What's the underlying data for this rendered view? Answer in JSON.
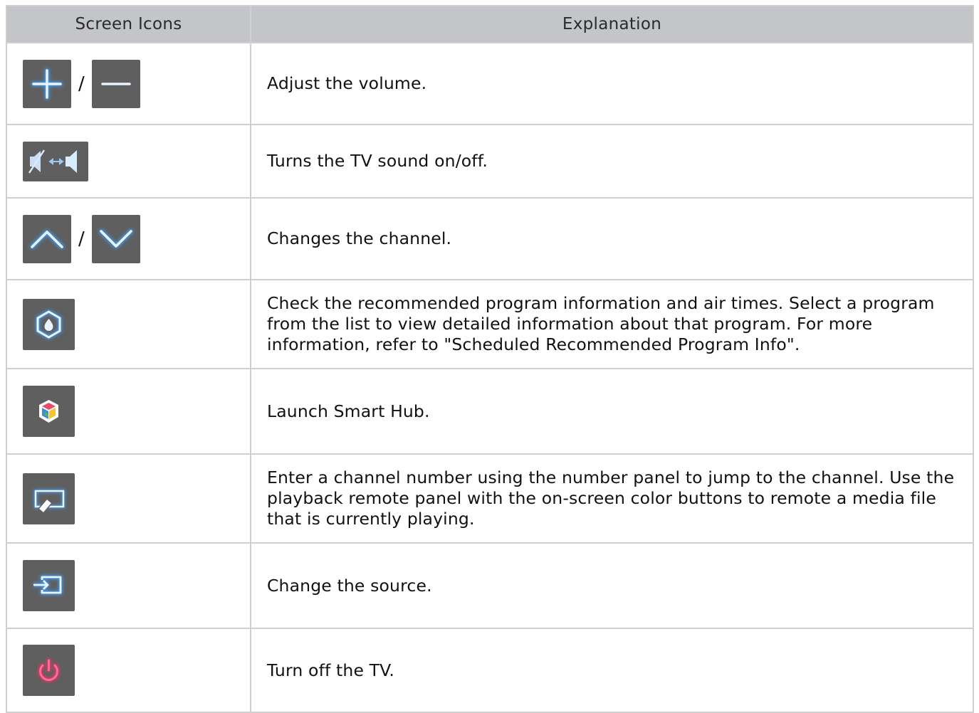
{
  "header": {
    "col_icons": "Screen Icons",
    "col_explanation": "Explanation"
  },
  "separator": "/",
  "rows": [
    {
      "icons": [
        "plus-icon",
        "minus-icon"
      ],
      "text": "Adjust the volume."
    },
    {
      "icons": [
        "mute-toggle-icon"
      ],
      "text": "Turns the TV sound on/off."
    },
    {
      "icons": [
        "chevron-up-icon",
        "chevron-down-icon"
      ],
      "text": "Changes the channel."
    },
    {
      "icons": [
        "recommended-program-icon"
      ],
      "text": "Check the recommended program information and air times. Select a program from the list to view detailed information about that program. For more information, refer to \"Scheduled Recommended Program Info\"."
    },
    {
      "icons": [
        "smart-hub-icon"
      ],
      "text": "Launch Smart Hub."
    },
    {
      "icons": [
        "remote-panel-icon"
      ],
      "text": "Enter a channel number using the number panel to jump to the channel. Use the playback remote panel with the on-screen color buttons to remote a media file that is currently playing."
    },
    {
      "icons": [
        "source-icon"
      ],
      "text": "Change the source."
    },
    {
      "icons": [
        "power-icon"
      ],
      "text": "Turn off the TV."
    }
  ],
  "colors": {
    "header_bg": "#c3c5c8",
    "icon_bg": "#5f5f5f",
    "icon_glow_blue": "#3aa0ff",
    "icon_glow_red": "#ff2a6a",
    "border": "#cfcfcf"
  }
}
